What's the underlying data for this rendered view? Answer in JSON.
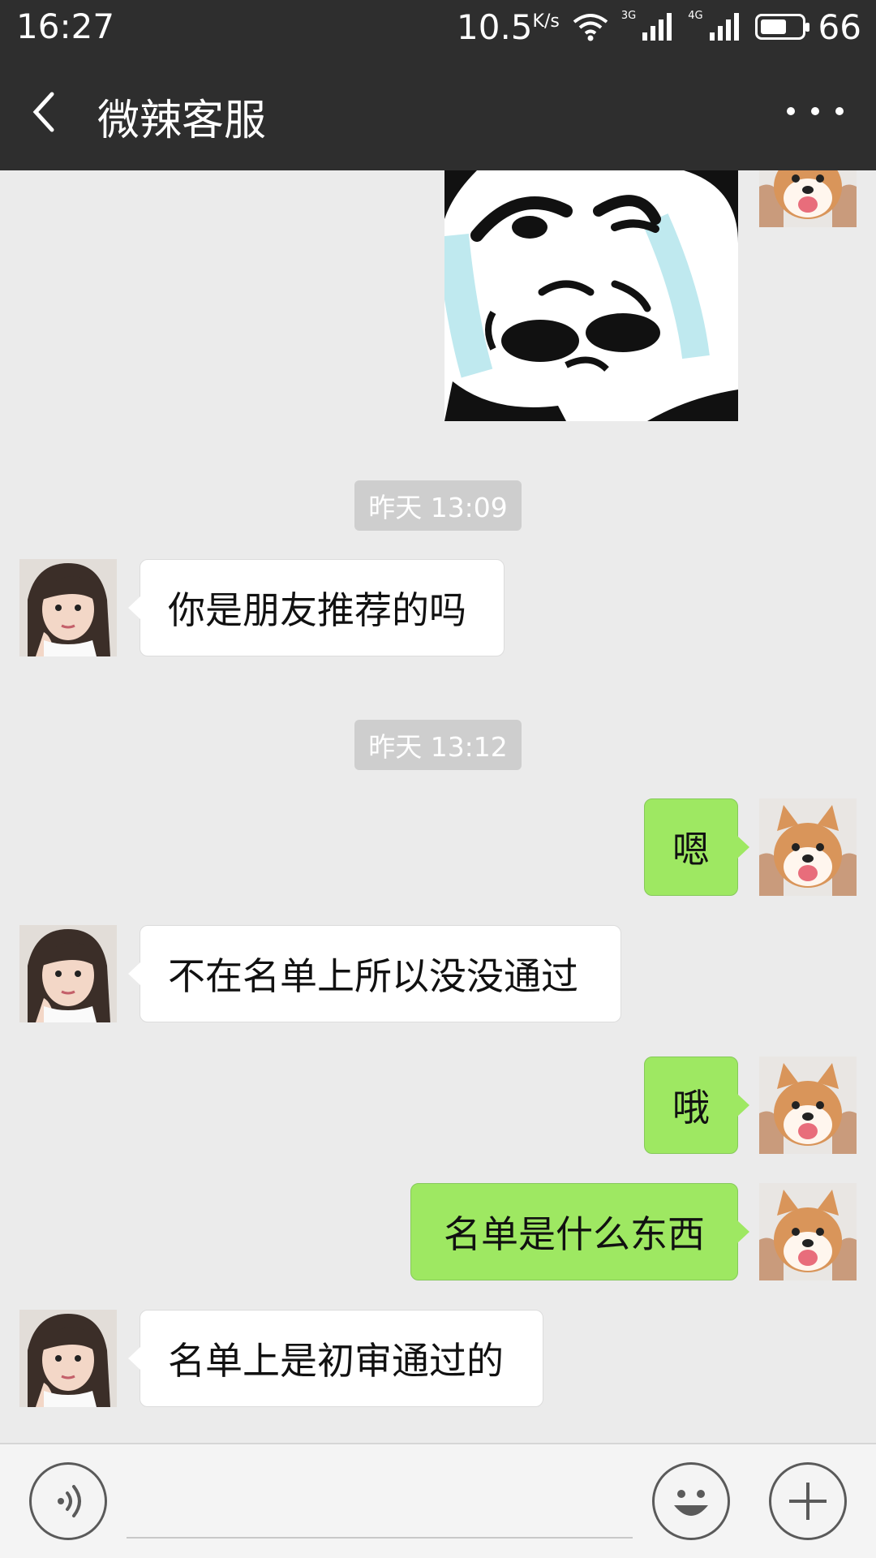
{
  "status_bar": {
    "time": "16:27",
    "net_speed": "10.5",
    "net_speed_unit": "K/s",
    "network_1": "3G",
    "network_2": "4G",
    "battery": "66"
  },
  "header": {
    "title": "微辣客服",
    "back_icon": "chevron-left-icon",
    "more_icon": "more-dots-icon"
  },
  "messages": [
    {
      "type": "sticker",
      "side": "right",
      "description_icon": "crying-panda-sticker"
    },
    {
      "type": "timestamp",
      "text": "昨天 13:09"
    },
    {
      "type": "text",
      "side": "left",
      "text": "你是朋友推荐的吗"
    },
    {
      "type": "timestamp",
      "text": "昨天 13:12"
    },
    {
      "type": "text",
      "side": "right",
      "text": "嗯"
    },
    {
      "type": "text",
      "side": "left",
      "text": "不在名单上所以没没通过"
    },
    {
      "type": "text",
      "side": "right",
      "text": "哦"
    },
    {
      "type": "text",
      "side": "right",
      "text": "名单是什么东西"
    },
    {
      "type": "text",
      "side": "left",
      "text": "名单上是初审通过的"
    }
  ],
  "input_bar": {
    "voice_icon": "voice-icon",
    "emoji_icon": "emoji-icon",
    "plus_icon": "plus-icon"
  },
  "colors": {
    "header_bg": "#2e2e2e",
    "chat_bg": "#ebebeb",
    "my_bubble": "#9ee862",
    "their_bubble": "#ffffff"
  }
}
